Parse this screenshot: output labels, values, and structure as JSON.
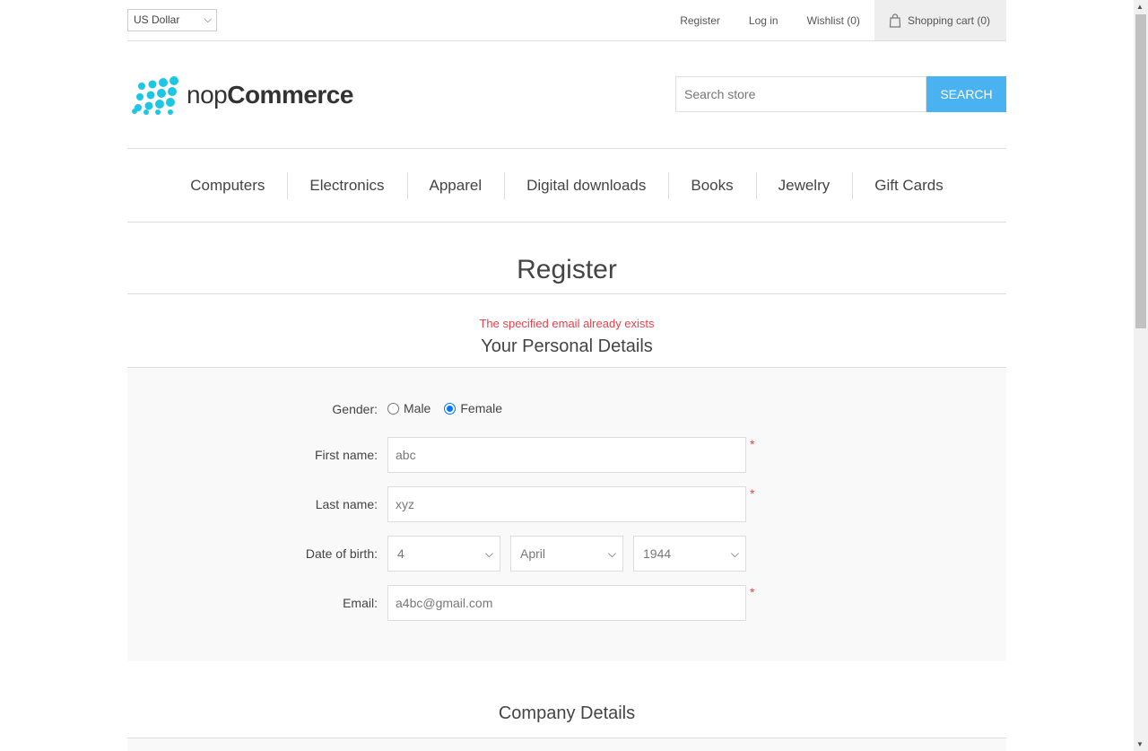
{
  "header": {
    "currency": "US Dollar",
    "links": {
      "register": "Register",
      "login": "Log in",
      "wishlist": "Wishlist (0)",
      "cart": "Shopping cart (0)"
    }
  },
  "logo": {
    "text_light": "nop",
    "text_bold": "Commerce"
  },
  "search": {
    "placeholder": "Search store",
    "button": "SEARCH"
  },
  "menu": [
    "Computers",
    "Electronics",
    "Apparel",
    "Digital downloads",
    "Books",
    "Jewelry",
    "Gift Cards"
  ],
  "page_title": "Register",
  "error_message": "The specified email already exists",
  "personal_section_title": "Your Personal Details",
  "form": {
    "gender_label": "Gender:",
    "gender_options": [
      "Male",
      "Female"
    ],
    "gender_selected": "Female",
    "first_name_label": "First name:",
    "first_name_value": "abc",
    "last_name_label": "Last name:",
    "last_name_value": "xyz",
    "dob_label": "Date of birth:",
    "dob_day": "4",
    "dob_month": "April",
    "dob_year": "1944",
    "email_label": "Email:",
    "email_value": "a4bc@gmail.com",
    "required_marker": "*"
  },
  "company_section_title": "Company Details",
  "colors": {
    "accent": "#4ab2f1",
    "logo": "#1ec6e6",
    "error": "#e4434b"
  }
}
